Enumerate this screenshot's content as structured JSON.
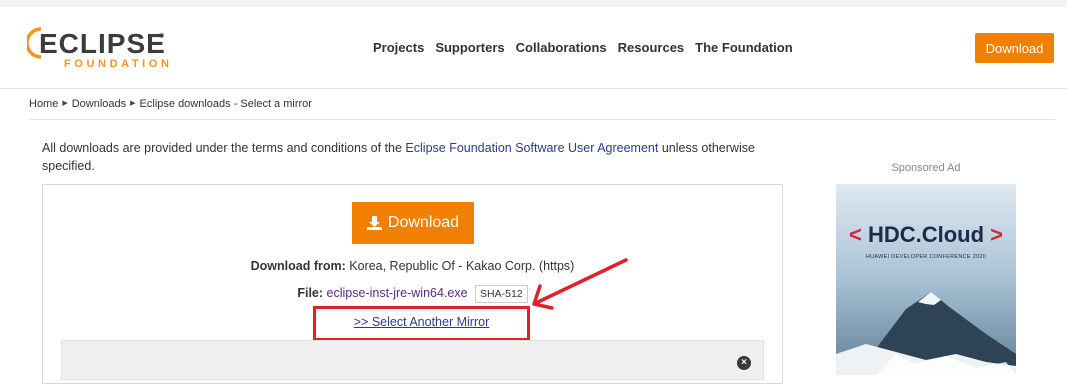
{
  "header": {
    "logo_main": "ECLIPSE",
    "logo_sub": "FOUNDATION",
    "logo_reg": "®",
    "nav": [
      "Projects",
      "Supporters",
      "Collaborations",
      "Resources",
      "The Foundation"
    ],
    "download_label": "Download"
  },
  "breadcrumb": {
    "home": "Home",
    "downloads": "Downloads",
    "current": "Eclipse downloads - Select a mirror"
  },
  "terms": {
    "before": "All downloads are provided under the terms and conditions of the ",
    "link": "Eclipse Foundation Software User Agreement",
    "after": " unless otherwise specified."
  },
  "download_panel": {
    "button_label": "Download",
    "from_label": "Download from:",
    "from_value": "Korea, Republic Of - Kakao Corp. (https)",
    "file_label": "File:",
    "file_name": "eclipse-inst-jre-win64.exe",
    "sha_label": "SHA-512",
    "mirror_link": ">> Select Another Mirror",
    "close_symbol": "×"
  },
  "sidebar": {
    "sponsored_label": "Sponsored Ad",
    "ad_title_left": "<",
    "ad_title_main": "HDC.Cloud",
    "ad_title_right": ">",
    "ad_subtitle": "HUAWEI DEVELOPER CONFERENCE 2020"
  },
  "colors": {
    "accent": "#f28000",
    "link": "#2b3a8c",
    "file_link": "#5b2a86",
    "annotation": "#e0202b"
  }
}
